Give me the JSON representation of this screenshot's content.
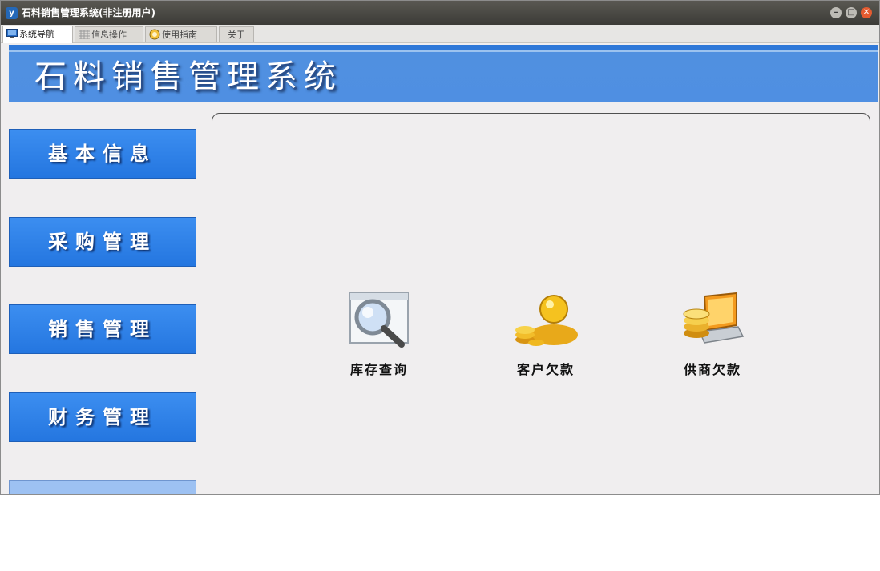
{
  "window": {
    "title": "石料销售管理系统(非注册用户)",
    "app_icon_text": "y"
  },
  "tabs": [
    {
      "label": "系统导航",
      "icon": "monitor-icon",
      "active": true
    },
    {
      "label": "信息操作",
      "icon": "grid-icon",
      "active": false
    },
    {
      "label": "使用指南",
      "icon": "help-icon",
      "active": false
    },
    {
      "label": "关于",
      "icon": "",
      "active": false
    }
  ],
  "banner": {
    "title": "石料销售管理系统"
  },
  "nav": [
    {
      "label": "基本信息"
    },
    {
      "label": "采购管理"
    },
    {
      "label": "销售管理"
    },
    {
      "label": "财务管理"
    }
  ],
  "quick_actions": [
    {
      "label": "库存查询",
      "icon": "magnifier-icon"
    },
    {
      "label": "客户欠款",
      "icon": "customer-coins-icon"
    },
    {
      "label": "供商欠款",
      "icon": "laptop-coins-icon"
    }
  ],
  "colors": {
    "titlebar": "#3c3b37",
    "banner": "#4f8fe2",
    "nav_button": "#2476e0",
    "close": "#e45b30"
  }
}
